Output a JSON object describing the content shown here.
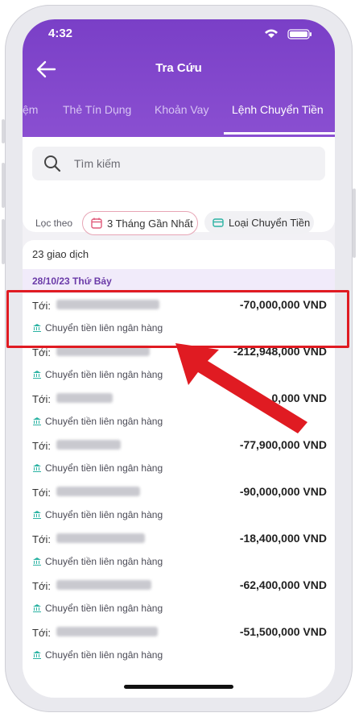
{
  "status": {
    "time": "4:32"
  },
  "header": {
    "title": "Tra Cứu"
  },
  "tabs": [
    {
      "label": "ệm",
      "active": false
    },
    {
      "label": "Thẻ Tín Dụng",
      "active": false
    },
    {
      "label": "Khoản Vay",
      "active": false
    },
    {
      "label": "Lệnh Chuyển Tiền",
      "active": true
    }
  ],
  "search": {
    "placeholder": "Tìm kiếm"
  },
  "filters": {
    "label": "Lọc theo",
    "period": "3 Tháng Gần Nhất",
    "type": "Loại Chuyển Tiền"
  },
  "list": {
    "count": "23 giao dịch",
    "date": "28/10/23 Thứ Bảy",
    "to_label": "Tới:",
    "items": [
      {
        "amount": "-70,000,000 VND",
        "type": "Chuyển tiền liên ngân hàng"
      },
      {
        "amount": "-212,948,000 VND",
        "type": "Chuyển tiền liên ngân hàng"
      },
      {
        "amount": "-2_,_0,000 VND",
        "type": "Chuyển tiền liên ngân hàng"
      },
      {
        "amount": "-77,900,000 VND",
        "type": "Chuyển tiền liên ngân hàng"
      },
      {
        "amount": "-90,000,000 VND",
        "type": "Chuyển tiền liên ngân hàng"
      },
      {
        "amount": "-18,400,000 VND",
        "type": "Chuyển tiền liên ngân hàng"
      },
      {
        "amount": "-62,400,000 VND",
        "type": "Chuyển tiền liên ngân hàng"
      },
      {
        "amount": "-51,500,000 VND",
        "type": "Chuyển tiền liên ngân hàng"
      }
    ]
  },
  "colors": {
    "accent": "#7a3fc7",
    "highlight": "#e01b22",
    "bank_icon": "#2bb3a3"
  }
}
